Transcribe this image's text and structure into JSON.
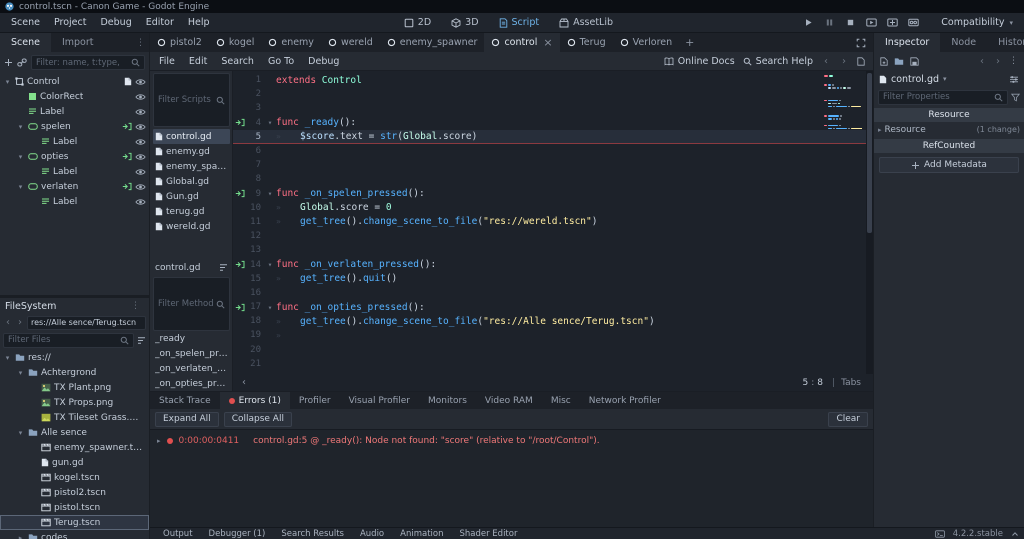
{
  "window": {
    "title": "control.tscn - Canon Game - Godot Engine"
  },
  "menubar": {
    "items": [
      "Scene",
      "Project",
      "Debug",
      "Editor",
      "Help"
    ]
  },
  "workspace": {
    "tabs": [
      {
        "label": "2D"
      },
      {
        "label": "3D"
      },
      {
        "label": "Script",
        "active": true
      },
      {
        "label": "AssetLib"
      }
    ],
    "renderer_label": "Compatibility"
  },
  "scene_panel": {
    "tabs": [
      {
        "label": "Scene",
        "active": true
      },
      {
        "label": "Import"
      }
    ],
    "filter_placeholder": "Filter: name, t:type,",
    "tree": [
      {
        "label": "Control",
        "icon": "control",
        "depth": 0,
        "expand": "open",
        "extras": [
          "script",
          "eye"
        ]
      },
      {
        "label": "ColorRect",
        "icon": "colorrect",
        "depth": 1,
        "extras": [
          "eye"
        ]
      },
      {
        "label": "Label",
        "icon": "label",
        "depth": 1,
        "extras": [
          "eye"
        ]
      },
      {
        "label": "spelen",
        "icon": "button",
        "depth": 1,
        "expand": "open",
        "extras": [
          "signal",
          "eye"
        ]
      },
      {
        "label": "Label",
        "icon": "label",
        "depth": 2,
        "extras": [
          "eye"
        ]
      },
      {
        "label": "opties",
        "icon": "button",
        "depth": 1,
        "expand": "open",
        "extras": [
          "signal",
          "eye"
        ]
      },
      {
        "label": "Label",
        "icon": "label",
        "depth": 2,
        "extras": [
          "eye"
        ]
      },
      {
        "label": "verlaten",
        "icon": "button",
        "depth": 1,
        "expand": "open",
        "extras": [
          "signal",
          "eye"
        ]
      },
      {
        "label": "Label",
        "icon": "label",
        "depth": 2,
        "extras": [
          "eye"
        ]
      }
    ]
  },
  "filesystem": {
    "title": "FileSystem",
    "path": "res://Alle sence/Terug.tscn",
    "filter_placeholder": "Filter Files",
    "tree": [
      {
        "label": "res://",
        "icon": "folder",
        "depth": 0,
        "expand": "open"
      },
      {
        "label": "Achtergrond",
        "icon": "folder",
        "depth": 1,
        "expand": "open"
      },
      {
        "label": "TX Plant.png",
        "icon": "image",
        "depth": 2
      },
      {
        "label": "TX Props.png",
        "icon": "image",
        "depth": 2
      },
      {
        "label": "TX Tileset Grass.png",
        "icon": "image-grass",
        "depth": 2
      },
      {
        "label": "Alle sence",
        "icon": "folder",
        "depth": 1,
        "expand": "open"
      },
      {
        "label": "enemy_spawner.tscn",
        "icon": "scene",
        "depth": 2
      },
      {
        "label": "gun.gd",
        "icon": "script",
        "depth": 2
      },
      {
        "label": "kogel.tscn",
        "icon": "scene",
        "depth": 2
      },
      {
        "label": "pistol2.tscn",
        "icon": "scene",
        "depth": 2
      },
      {
        "label": "pistol.tscn",
        "icon": "scene",
        "depth": 2
      },
      {
        "label": "Terug.tscn",
        "icon": "scene",
        "depth": 2,
        "selected": true
      },
      {
        "label": "codes",
        "icon": "folder",
        "depth": 1,
        "expand": "closed"
      }
    ]
  },
  "scene_tabs": {
    "tabs": [
      {
        "label": "pistol2"
      },
      {
        "label": "kogel"
      },
      {
        "label": "enemy"
      },
      {
        "label": "wereld"
      },
      {
        "label": "enemy_spawner"
      },
      {
        "label": "control",
        "active": true
      },
      {
        "label": "Terug"
      },
      {
        "label": "Verloren"
      }
    ]
  },
  "script_editor": {
    "menus": [
      "File",
      "Edit",
      "Search",
      "Go To",
      "Debug"
    ],
    "online_docs_label": "Online Docs",
    "search_help_label": "Search Help",
    "scripts_filter_placeholder": "Filter Scripts",
    "scripts": [
      {
        "label": "control.gd",
        "selected": true
      },
      {
        "label": "enemy.gd"
      },
      {
        "label": "enemy_spawne..."
      },
      {
        "label": "Global.gd"
      },
      {
        "label": "Gun.gd"
      },
      {
        "label": "terug.gd"
      },
      {
        "label": "wereld.gd"
      }
    ],
    "member_dropdown_label": "control.gd",
    "methods_filter_placeholder": "Filter Methods",
    "methods": [
      "_ready",
      "_on_spelen_pressed",
      "_on_verlaten_press...",
      "_on_opties_pressed"
    ],
    "status": {
      "line": "5",
      "col": "8",
      "separator": "|",
      "indent_label": "Tabs"
    },
    "code": {
      "lines": [
        {
          "n": 1,
          "t": [
            [
              "extends ",
              "kw"
            ],
            [
              "Control",
              "type"
            ]
          ]
        },
        {
          "n": 2,
          "t": []
        },
        {
          "n": 3,
          "t": []
        },
        {
          "n": 4,
          "signal": true,
          "fold": true,
          "t": [
            [
              "func ",
              "kw"
            ],
            [
              "_ready",
              "fn"
            ],
            [
              "():",
              "txt"
            ]
          ]
        },
        {
          "n": 5,
          "indent": 1,
          "error": true,
          "current": true,
          "t": [
            [
              "$score",
              "np"
            ],
            [
              ".text = ",
              "txt"
            ],
            [
              "str",
              "fn"
            ],
            [
              "(",
              "txt"
            ],
            [
              "Global",
              "type2"
            ],
            [
              ".score)",
              "txt"
            ]
          ]
        },
        {
          "n": 6,
          "t": []
        },
        {
          "n": 7,
          "t": []
        },
        {
          "n": 8,
          "t": []
        },
        {
          "n": 9,
          "signal": true,
          "fold": true,
          "t": [
            [
              "func ",
              "kw"
            ],
            [
              "_on_spelen_pressed",
              "fn"
            ],
            [
              "():",
              "txt"
            ]
          ]
        },
        {
          "n": 10,
          "indent": 1,
          "t": [
            [
              "Global",
              "type2"
            ],
            [
              ".score = ",
              "txt"
            ],
            [
              "0",
              "num"
            ]
          ]
        },
        {
          "n": 11,
          "indent": 1,
          "t": [
            [
              "get_tree",
              "fn"
            ],
            [
              "().",
              "txt"
            ],
            [
              "change_scene_to_file",
              "fn"
            ],
            [
              "(",
              "txt"
            ],
            [
              "\"res://wereld.tscn\"",
              "str"
            ],
            [
              ")",
              "txt"
            ]
          ]
        },
        {
          "n": 12,
          "t": []
        },
        {
          "n": 13,
          "t": []
        },
        {
          "n": 14,
          "signal": true,
          "fold": true,
          "t": [
            [
              "func ",
              "kw"
            ],
            [
              "_on_verlaten_pressed",
              "fn"
            ],
            [
              "():",
              "txt"
            ]
          ]
        },
        {
          "n": 15,
          "indent": 1,
          "t": [
            [
              "get_tree",
              "fn"
            ],
            [
              "().",
              "txt"
            ],
            [
              "quit",
              "fn"
            ],
            [
              "()",
              "txt"
            ]
          ]
        },
        {
          "n": 16,
          "t": []
        },
        {
          "n": 17,
          "signal": true,
          "fold": true,
          "t": [
            [
              "func ",
              "kw"
            ],
            [
              "_on_opties_pressed",
              "fn"
            ],
            [
              "():",
              "txt"
            ]
          ]
        },
        {
          "n": 18,
          "indent": 1,
          "t": [
            [
              "get_tree",
              "fn"
            ],
            [
              "().",
              "txt"
            ],
            [
              "change_scene_to_file",
              "fn"
            ],
            [
              "(",
              "txt"
            ],
            [
              "\"res://Alle sence/Terug.tscn\"",
              "str"
            ],
            [
              ")",
              "txt"
            ]
          ]
        },
        {
          "n": 19,
          "indent": 1,
          "t": []
        },
        {
          "n": 20,
          "t": []
        },
        {
          "n": 21,
          "t": []
        }
      ]
    }
  },
  "debugger": {
    "tabs": [
      {
        "label": "Stack Trace"
      },
      {
        "label": "Errors (1)",
        "active": true,
        "dot": true
      },
      {
        "label": "Profiler"
      },
      {
        "label": "Visual Profiler"
      },
      {
        "label": "Monitors"
      },
      {
        "label": "Video RAM"
      },
      {
        "label": "Misc"
      },
      {
        "label": "Network Profiler"
      }
    ],
    "expand_all_label": "Expand All",
    "collapse_all_label": "Collapse All",
    "clear_label": "Clear",
    "errors": [
      {
        "time": "0:00:00:0411",
        "message": "control.gd:5 @ _ready(): Node not found: \"score\" (relative to \"/root/Control\")."
      }
    ]
  },
  "bottom_bar": {
    "items": [
      {
        "label": "Output"
      },
      {
        "label": "Debugger (1)"
      },
      {
        "label": "Search Results"
      },
      {
        "label": "Audio"
      },
      {
        "label": "Animation"
      },
      {
        "label": "Shader Editor"
      }
    ],
    "version": "4.2.2.stable"
  },
  "inspector": {
    "tabs": [
      {
        "label": "Inspector",
        "active": true
      },
      {
        "label": "Node"
      },
      {
        "label": "History"
      }
    ],
    "object_label": "control.gd",
    "filter_placeholder": "Filter Properties",
    "category_resource": "Resource",
    "group_label": "Resource",
    "group_badge": "(1 change)",
    "category_refcounted": "RefCounted",
    "add_metadata_label": "Add Metadata"
  }
}
